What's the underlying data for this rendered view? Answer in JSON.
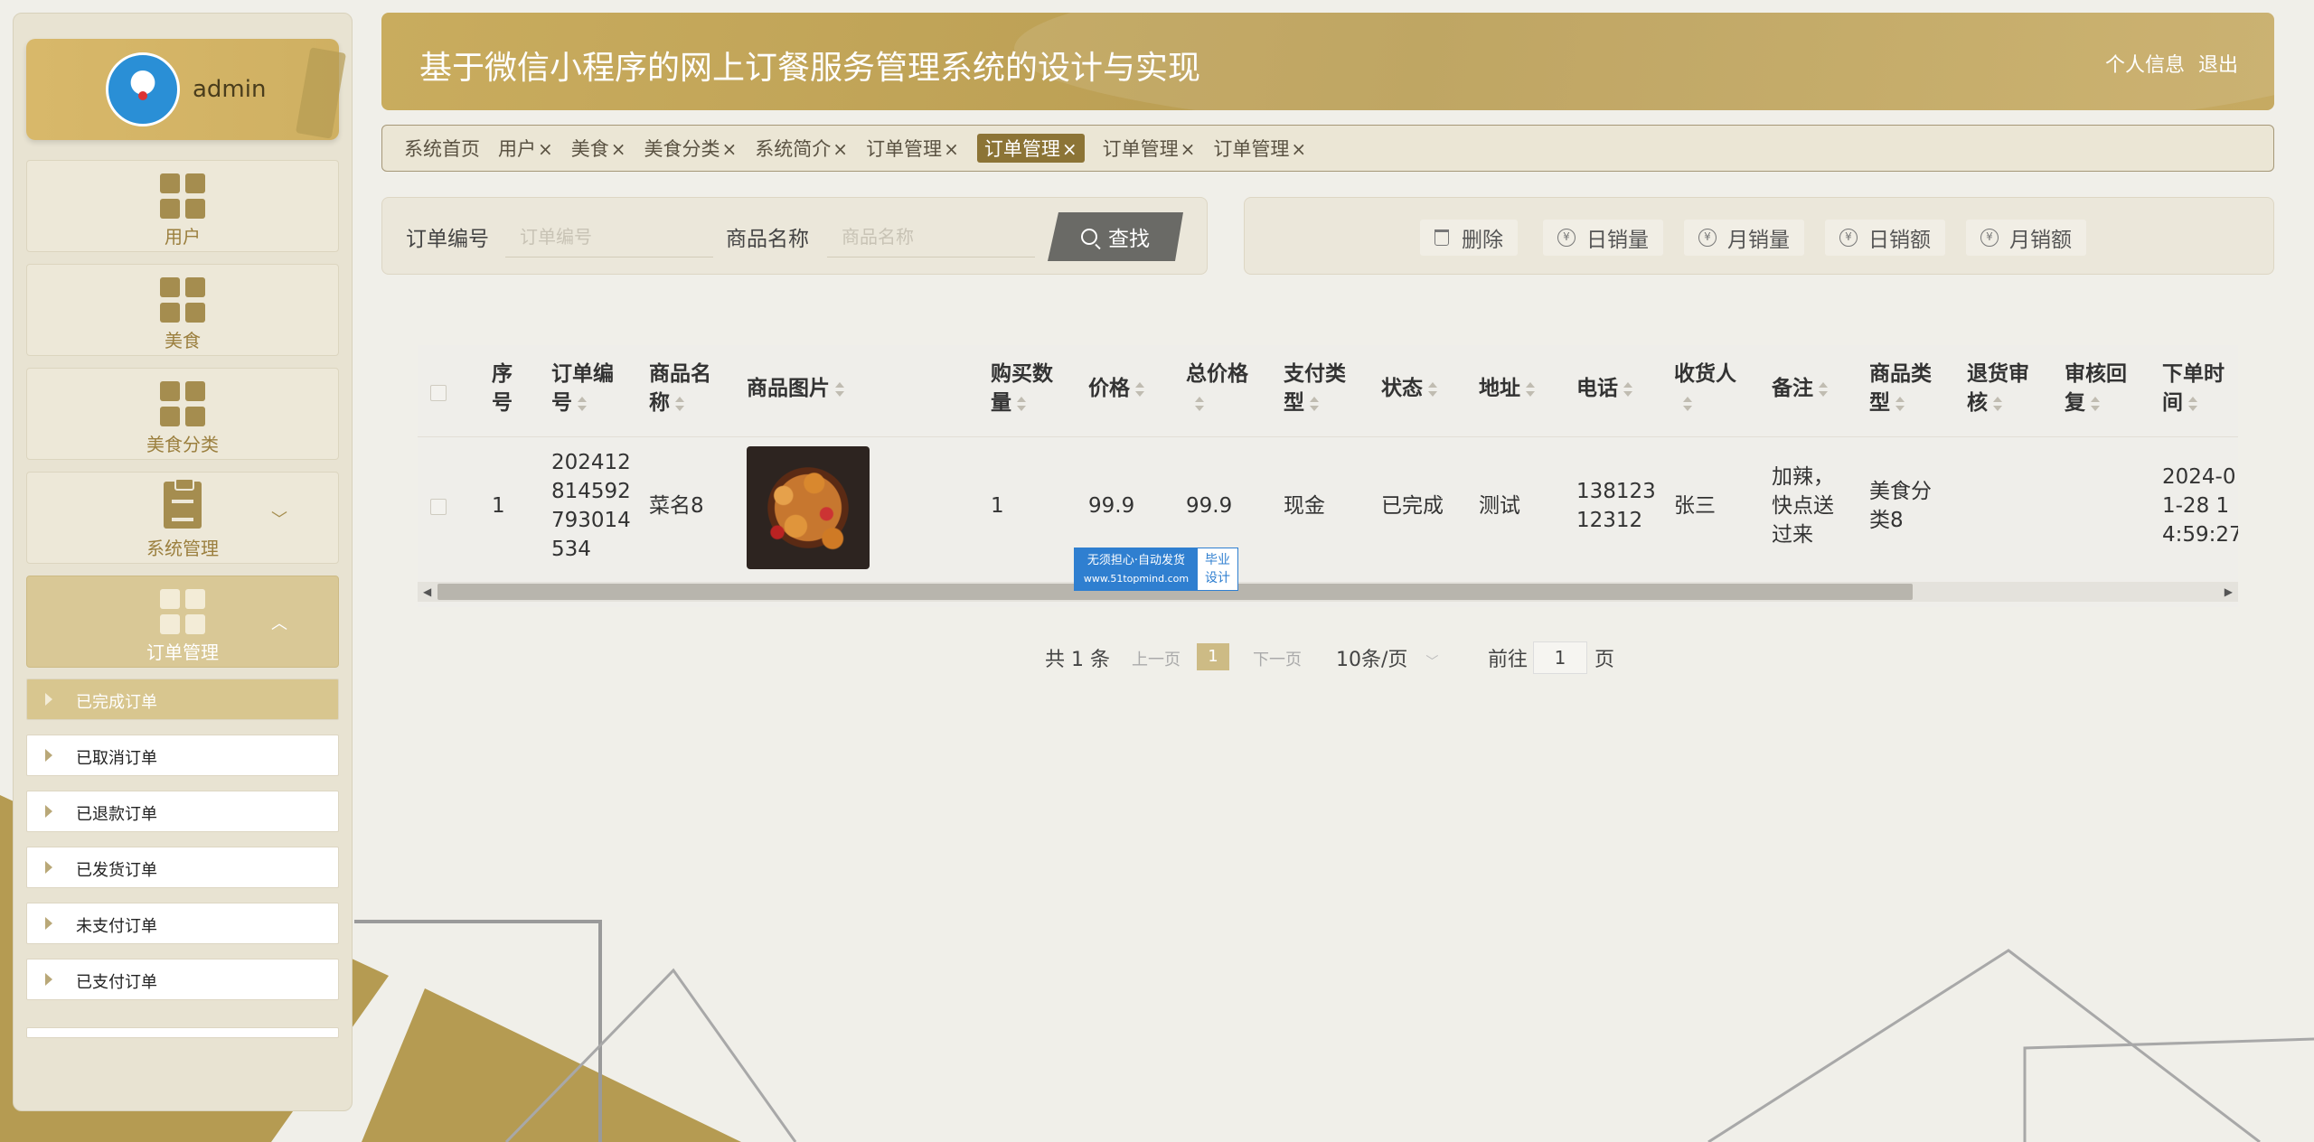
{
  "user": {
    "name": "admin"
  },
  "menu": [
    {
      "label": "用户",
      "icon": "grid-icon"
    },
    {
      "label": "美食",
      "icon": "grid-icon"
    },
    {
      "label": "美食分类",
      "icon": "grid-icon"
    },
    {
      "label": "系统管理",
      "icon": "clipboard-icon"
    },
    {
      "label": "订单管理",
      "icon": "grid-icon"
    }
  ],
  "submenu": [
    {
      "label": "已完成订单"
    },
    {
      "label": "已取消订单"
    },
    {
      "label": "已退款订单"
    },
    {
      "label": "已发货订单"
    },
    {
      "label": "未支付订单"
    },
    {
      "label": "已支付订单"
    }
  ],
  "header": {
    "title": "基于微信小程序的网上订餐服务管理系统的设计与实现",
    "profile_link": "个人信息",
    "logout_link": "退出"
  },
  "tags": [
    {
      "label": "系统首页"
    },
    {
      "label": "用户"
    },
    {
      "label": "美食"
    },
    {
      "label": "美食分类"
    },
    {
      "label": "系统简介"
    },
    {
      "label": "订单管理"
    },
    {
      "label": "订单管理"
    },
    {
      "label": "订单管理"
    },
    {
      "label": "订单管理"
    }
  ],
  "tag_close": "×",
  "search": {
    "order_no_label": "订单编号",
    "order_no_placeholder": "订单编号",
    "product_label": "商品名称",
    "product_placeholder": "商品名称",
    "button": "查找"
  },
  "actions": {
    "delete": "删除",
    "daily_sales": "日销量",
    "monthly_sales": "月销量",
    "daily_revenue": "日销额",
    "monthly_revenue": "月销额"
  },
  "table": {
    "headers": {
      "index": [
        "序",
        "号"
      ],
      "order_no": [
        "订单编",
        "号"
      ],
      "product_name": [
        "商品名",
        "称"
      ],
      "image": "商品图片",
      "qty": [
        "购买数",
        "量"
      ],
      "price": "价格",
      "total": [
        "总价格",
        ""
      ],
      "pay_type": [
        "支付类",
        "型"
      ],
      "status": "状态",
      "address": "地址",
      "phone": "电话",
      "receiver": [
        "收货人",
        ""
      ],
      "note": "备注",
      "category": [
        "商品类",
        "型"
      ],
      "refund_review": [
        "退货审",
        "核"
      ],
      "review_reply": [
        "审核回",
        "复"
      ],
      "order_time": [
        "下单时",
        "间"
      ]
    },
    "rows": [
      {
        "index": "1",
        "order_no": [
          "202412",
          "814592",
          "793014",
          "534"
        ],
        "product_name": "菜名8",
        "qty": "1",
        "price": "99.9",
        "total": "99.9",
        "pay_type": "现金",
        "status": "已完成",
        "address": "测试",
        "phone": [
          "138123",
          "12312"
        ],
        "receiver": "张三",
        "note": [
          "加辣，",
          "快点送",
          "过来"
        ],
        "category": [
          "美食分",
          "类8"
        ],
        "refund_review": "",
        "review_reply": "",
        "order_time": [
          "2024-0",
          "1-28 1",
          "4:59:27"
        ]
      }
    ]
  },
  "watermark": {
    "line1": "无须担心·自动发货",
    "line2": "www.51topmind.com",
    "right1": "毕业",
    "right2": "设计"
  },
  "pagination": {
    "total": "共 1 条",
    "prev": "上一页",
    "current": "1",
    "next": "下一页",
    "page_size": "10条/页",
    "goto_prefix": "前往",
    "goto_value": "1",
    "goto_suffix": "页"
  },
  "colors": {
    "accent": "#c9ac5e",
    "accent_dark": "#8c7436",
    "active_menu": "#d9c896"
  }
}
